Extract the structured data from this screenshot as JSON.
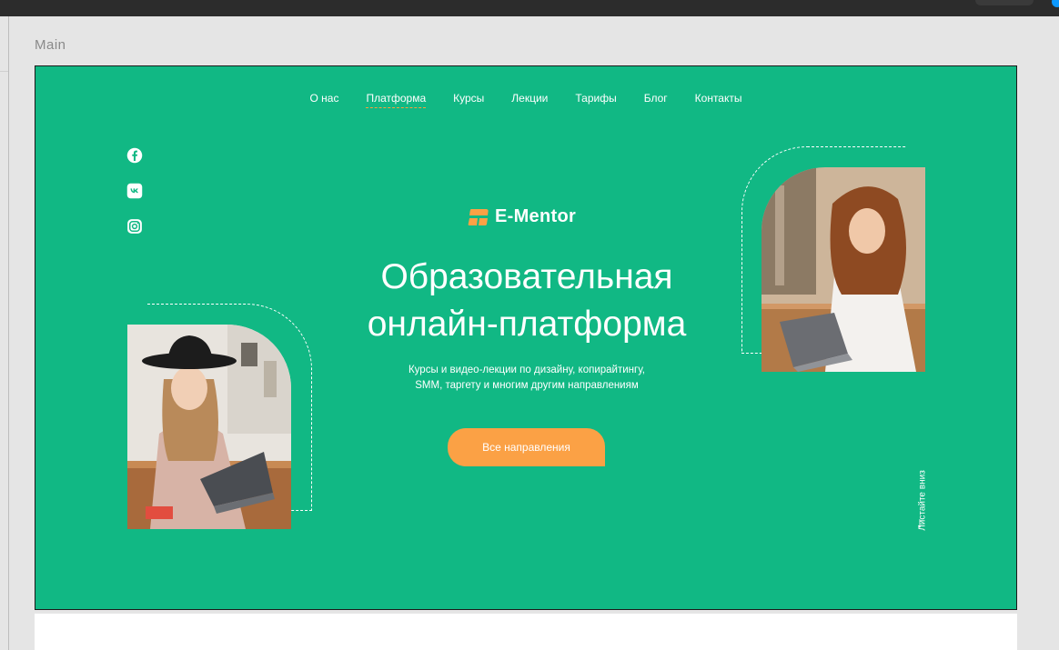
{
  "canvas": {
    "frame_label": "Main"
  },
  "nav": {
    "items": [
      {
        "label": "О нас"
      },
      {
        "label": "Платформа",
        "active": true
      },
      {
        "label": "Курсы"
      },
      {
        "label": "Лекции"
      },
      {
        "label": "Тарифы"
      },
      {
        "label": "Блог"
      },
      {
        "label": "Контакты"
      }
    ]
  },
  "social": [
    {
      "icon": "facebook-icon"
    },
    {
      "icon": "vk-icon"
    },
    {
      "icon": "instagram-icon"
    }
  ],
  "brand": {
    "name": "E-Mentor",
    "logo_color": "#fba145"
  },
  "hero": {
    "title_line1": "Образовательная",
    "title_line2": "онлайн-платформа",
    "subtitle_line1": "Курсы и видео-лекции по дизайну, копирайтингу,",
    "subtitle_line2": "SMM, таргету и многим другим направлениям",
    "cta_label": "Все направления"
  },
  "scroll_hint": {
    "label": "Листайте вниз",
    "arrow": "↓"
  },
  "colors": {
    "background": "#11b884",
    "accent": "#fba145",
    "text": "#ffffff"
  }
}
